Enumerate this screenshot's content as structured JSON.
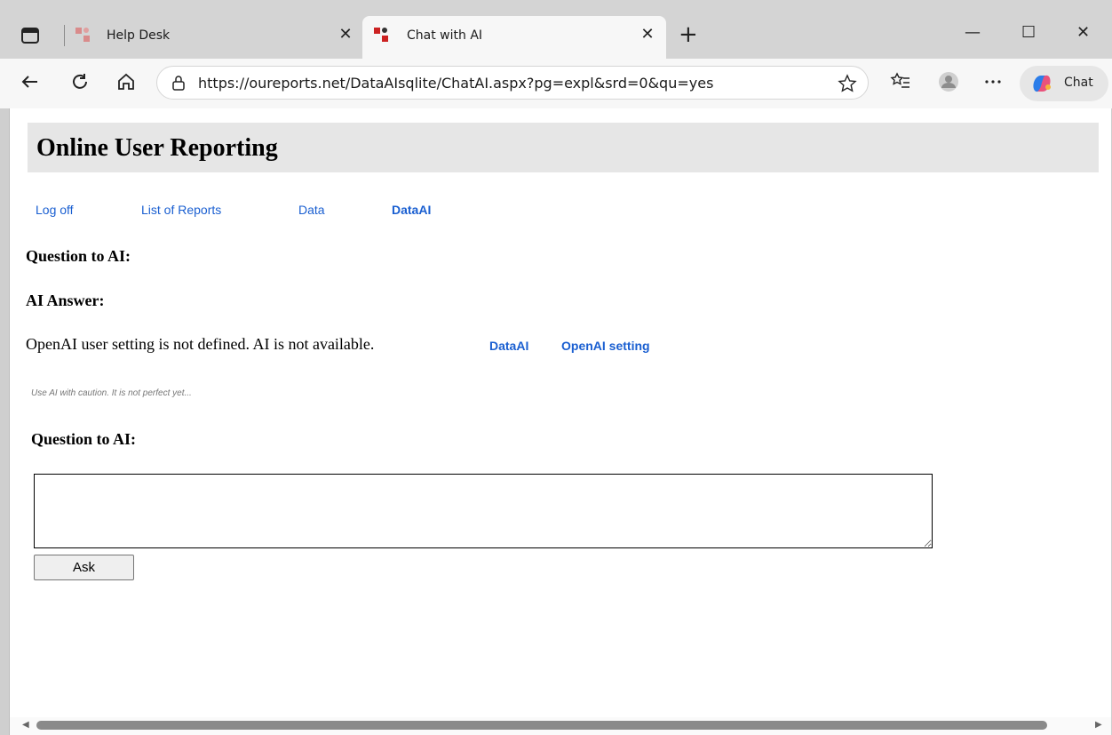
{
  "browser": {
    "tabs": [
      {
        "label": "Help Desk",
        "active": false
      },
      {
        "label": "Chat with AI",
        "active": true
      }
    ],
    "url": "https://oureports.net/DataAIsqlite/ChatAI.aspx?pg=expl&srd=0&qu=yes",
    "copilot_label": "Chat",
    "window_controls": {
      "minimize": "—",
      "maximize": "☐",
      "close": "✕"
    },
    "tab_close": "✕",
    "new_tab": "+"
  },
  "page": {
    "title": "Online User Reporting",
    "nav": [
      "Log off",
      "List of Reports",
      "Data",
      "DataAI"
    ],
    "question_heading": "Question to AI:",
    "answer_heading": "AI Answer:",
    "answer_text": "OpenAI user setting is not defined. AI is not available.",
    "answer_links": [
      "DataAI",
      "OpenAI setting"
    ],
    "caution": "Use AI with caution. It is not perfect yet...",
    "question_heading_2": "Question to AI:",
    "question_input_value": "",
    "ask_label": "Ask"
  },
  "colors": {
    "link": "#1a5fd1",
    "header_bg": "#e6e6e6"
  }
}
